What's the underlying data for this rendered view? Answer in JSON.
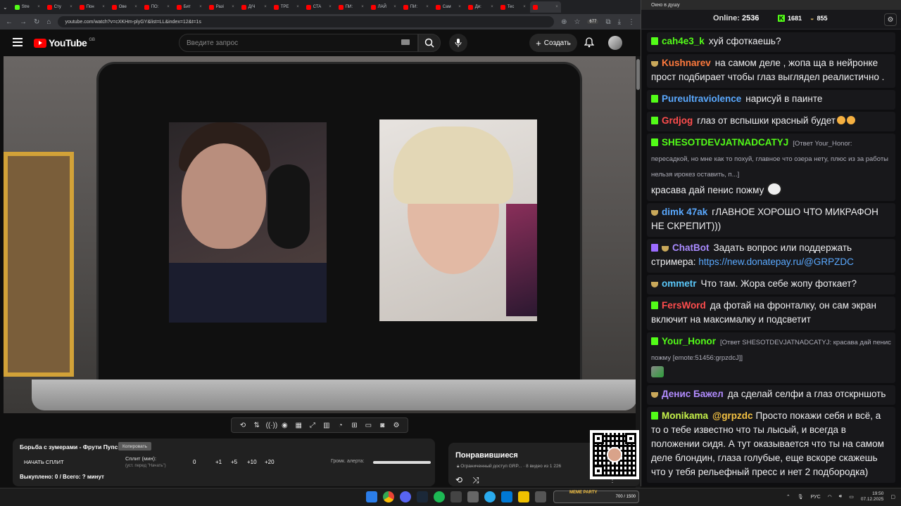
{
  "browser": {
    "tabs": [
      "Stre",
      "Сту",
      "Пон",
      "Ове",
      "ПО:",
      "Бит",
      "Разі",
      "Д/Ч",
      "ТРЕ",
      "СТА",
      "ПИ:",
      "ЛАЙ",
      "ПИ:",
      "Сам",
      "Ди:",
      "Тес",
      ""
    ],
    "url": "youtube.com/watch?v=cXKHm-plyGY&list=LL&index=12&t=1s",
    "ext_badge": "677"
  },
  "youtube": {
    "logo_text": "YouTube",
    "region": "GB",
    "search_placeholder": "Введите запрос",
    "create_label": "Создать"
  },
  "split_panel": {
    "title": "Борьба с зумерами - Фрути Пупс",
    "copy_label": "Копировать",
    "start_label": "НАЧАТЬ СПЛИТ",
    "split_label": "Сплит (мин):",
    "split_hint": "(уст. перед \"Начать\")",
    "split_value": "0",
    "increments": [
      "+1",
      "+5",
      "+10",
      "+20"
    ],
    "alert_label": "Громк. алерта:",
    "done_text": "Выкуплено: 0 / Всего: ? минут"
  },
  "liked_panel": {
    "title": "Понравившиеся",
    "subtitle": "Ограниченный доступ GRP...  · 8 видео из 1 226"
  },
  "chat_window": {
    "title": "Окно в душу",
    "online_label": "Online:",
    "online_count": "2536",
    "kick_count": "1681",
    "other_count": "855"
  },
  "chat": [
    {
      "badges": [
        "k"
      ],
      "nick": "cah4e3_k",
      "color": "#53fc18",
      "text": "хуй сфоткаешь?"
    },
    {
      "badges": [
        "bowl"
      ],
      "nick": "Kushnarev",
      "color": "#ff7a3d",
      "text": "на самом деле , жопа ща в нейронке прост подбирает чтобы глаз выглядел реалистично ."
    },
    {
      "badges": [
        "k"
      ],
      "nick": "Pureultraviolence",
      "color": "#5aa9ff",
      "text": "нарисуй в паинте"
    },
    {
      "badges": [
        "k"
      ],
      "nick": "Grdjog",
      "color": "#ff4d4d",
      "text": "глаз от вспышки красный будет"
    },
    {
      "badges": [
        "k"
      ],
      "nick": "SHESOTDEVJATNADCATYJ",
      "color": "#53fc18",
      "reply": "[Ответ Your_Honor: пересадкой, но мне как то похуй, главное что озера нету, плюс из за работы нельзя ирокез оставить, п...]",
      "text": "красава дай пенис пожму"
    },
    {
      "badges": [
        "bowl"
      ],
      "nick": "dimk 47ak",
      "color": "#5aa9ff",
      "text": "гЛАВНОЕ ХОРОШО ЧТО МИКРАФОН НЕ СКРЕПИТ)))"
    },
    {
      "badges": [
        "bot",
        "bowl"
      ],
      "nick": "ChatBot",
      "color": "#a98bff",
      "text": "Задать вопрос или поддержать стримера:",
      "link": "https://new.donatepay.ru/@GRPZDC"
    },
    {
      "badges": [
        "bowl"
      ],
      "nick": "ommetr",
      "color": "#5ac8fa",
      "text": "Что там. Жора себе жопу фоткает?"
    },
    {
      "badges": [
        "k"
      ],
      "nick": "FersWord",
      "color": "#ff4d4d",
      "text": "да фотай на фронталку, он сам экран включит на максималку и подсветит"
    },
    {
      "badges": [
        "k"
      ],
      "nick": "Your_Honor",
      "color": "#53fc18",
      "reply": "[Ответ SHESOTDEVJATNADCATYJ: красава дай пенис пожму [emote:51456:grpzdcJ]]",
      "text": ""
    },
    {
      "badges": [
        "bowl"
      ],
      "nick": "Денис Бажел",
      "color": "#b28cff",
      "text": "да сделай селфи а глаз отскрншоть"
    },
    {
      "badges": [
        "k"
      ],
      "nick": "Monikama",
      "color": "#c6f24a",
      "mention": "@grpzdc",
      "text": "Просто покажи себя и всё, а то о тебе известно что ты лысый, и всегда в положении сидя. А тут оказывается что ты на самом деле блондин, глаза голубые, еще вскоре скажешь что у тебя рельефный пресс и нет 2 подбородка)"
    }
  ],
  "taskbar": {
    "widget_label": "MEME PARTY",
    "widget_value": "700 / 1500",
    "lang": "РУС",
    "time": "19:50",
    "date": "07.12.2025"
  }
}
